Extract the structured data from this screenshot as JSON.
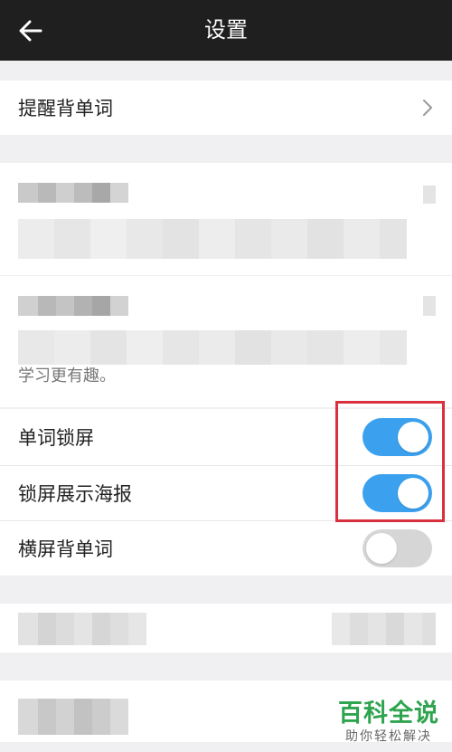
{
  "header": {
    "title": "设置"
  },
  "rows": {
    "remind": {
      "label": "提醒背单词"
    },
    "lock_words": {
      "label": "单词锁屏",
      "enabled": true
    },
    "lock_poster": {
      "label": "锁屏展示海报",
      "enabled": true
    },
    "landscape": {
      "label": "横屏背单词",
      "enabled": false
    }
  },
  "partial_text": "学习更有趣。",
  "colors": {
    "toggle_on": "#3ba1ee",
    "toggle_off": "#d6d6d6",
    "highlight": "#d9303f",
    "header_bg": "#1f1f1f"
  },
  "watermark": {
    "title": "百科全说",
    "subtitle": "助你轻松解决"
  }
}
